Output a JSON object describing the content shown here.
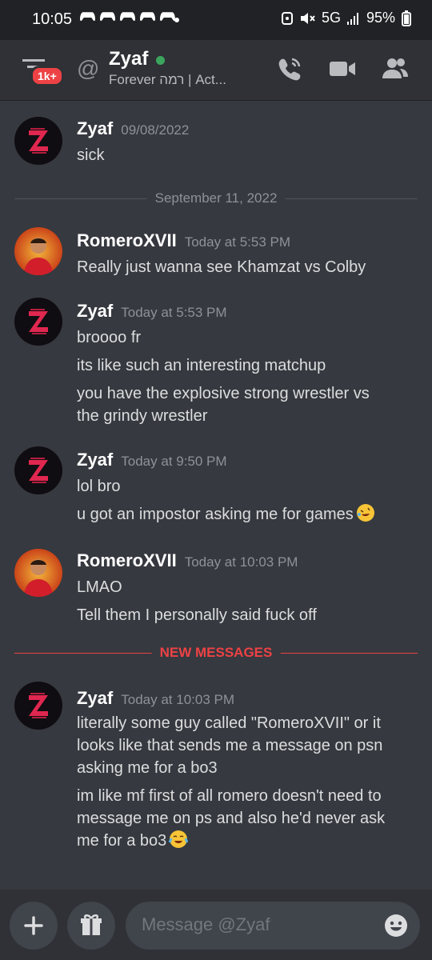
{
  "status_bar": {
    "time": "10:05",
    "network": "5G",
    "battery": "95%"
  },
  "header": {
    "badge": "1k+",
    "at_symbol": "@",
    "title": "Zyaf",
    "subtitle": "Forever רמה | Act..."
  },
  "messages": [
    {
      "author": "Zyaf",
      "timestamp": "09/08/2022",
      "lines": [
        "sick"
      ]
    },
    {
      "author": "RomeroXVII",
      "timestamp": "Today at 5:53 PM",
      "lines": [
        "Really just wanna see Khamzat vs Colby"
      ]
    },
    {
      "author": "Zyaf",
      "timestamp": "Today at 5:53 PM",
      "lines": [
        "broooo fr",
        "its like such an interesting matchup",
        "you have the explosive strong wrestler vs",
        "the grindy wrestler"
      ]
    },
    {
      "author": "Zyaf",
      "timestamp": "Today at 9:50 PM",
      "lines": [
        "lol bro",
        "u got an impostor asking me for games"
      ]
    },
    {
      "author": "RomeroXVII",
      "timestamp": "Today at 10:03 PM",
      "lines": [
        "LMAO",
        "Tell them I personally said fuck off"
      ]
    },
    {
      "author": "Zyaf",
      "timestamp": "Today at 10:03 PM",
      "lines": [
        "literally some guy called \"RomeroXVII\" or it",
        "looks like that sends me a message on psn",
        "asking me for a bo3",
        "im like mf first of all romero doesn't need to",
        "message me on ps and also he'd never ask",
        "me for a bo3"
      ]
    }
  ],
  "dividers": {
    "date": "September 11, 2022",
    "new": "NEW MESSAGES"
  },
  "composer": {
    "placeholder": "Message @Zyaf"
  },
  "colors": {
    "background": "#36393f",
    "header": "#2f3136",
    "accent_red": "#ed4245",
    "online": "#3ba55d"
  }
}
